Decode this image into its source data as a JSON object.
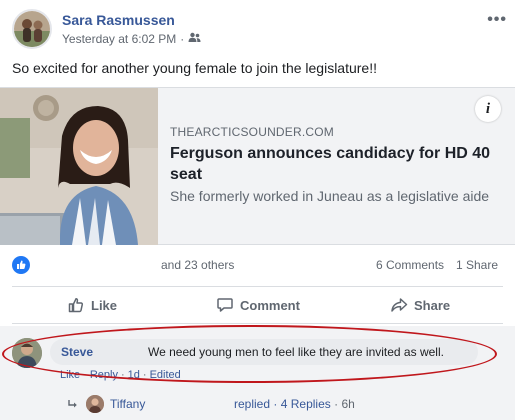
{
  "post": {
    "author": "Sara Rasmussen",
    "timestamp": "Yesterday at 6:02 PM",
    "separator": "·",
    "audience_icon": "friends-icon",
    "more_icon": "ellipsis-icon",
    "more_label": "•••",
    "text": "So excited for another young female to join the legislature!!"
  },
  "link_preview": {
    "domain": "THEARCTICSOUNDER.COM",
    "title": "Ferguson announces candidacy for HD 40 seat",
    "description": "She formerly worked in Juneau as a legislative aide",
    "info_label": "i"
  },
  "reactions": {
    "icon": "like-reaction-icon",
    "others_text": "and 23 others",
    "comments_text": "6 Comments",
    "shares_text": "1 Share"
  },
  "actions": {
    "like": "Like",
    "comment": "Comment",
    "share": "Share"
  },
  "comment": {
    "name": "Steve",
    "text": "We need young men to feel like they are invited as well.",
    "like": "Like",
    "dot": "·",
    "reply": "Reply",
    "time": "1d",
    "edited": "Edited"
  },
  "reply_summary": {
    "name": "Tiffany",
    "replied_label": "replied",
    "dot": "·",
    "count": "4 Replies",
    "time": "6h"
  },
  "colors": {
    "link_blue": "#385898",
    "like_blue": "#2078f4",
    "highlight_red": "#c0171c",
    "meta_gray": "#606770"
  }
}
